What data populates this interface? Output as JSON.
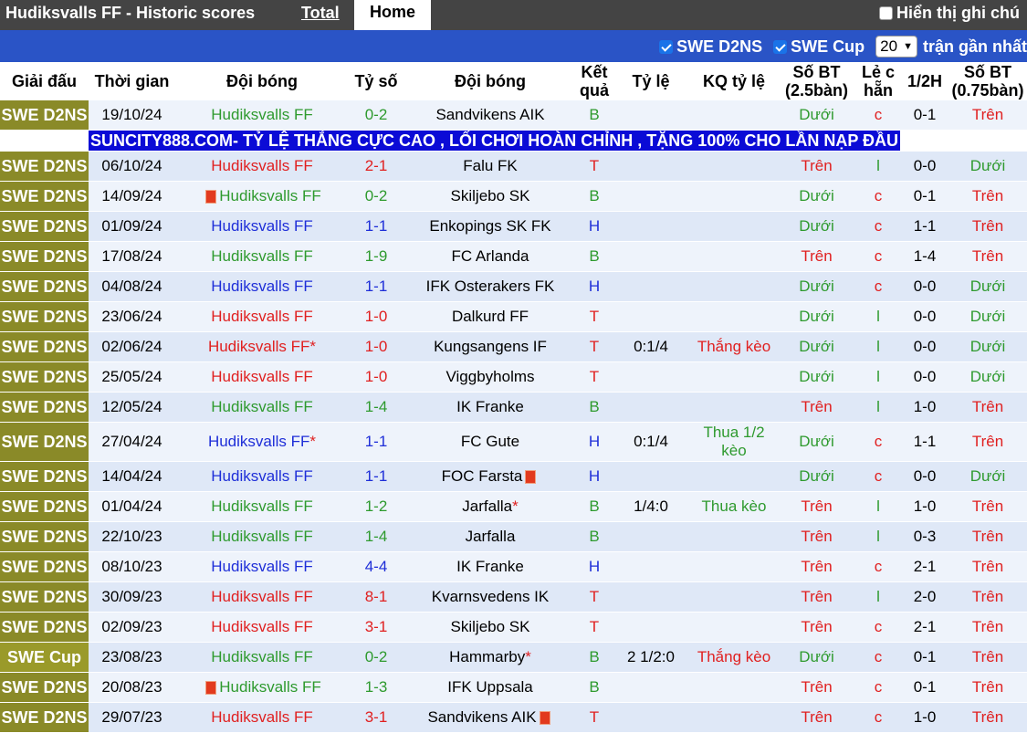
{
  "header": {
    "title": "Hudiksvalls FF - Historic scores",
    "tab_total": "Total",
    "tab_home": "Home",
    "show_notes": "Hiển thị ghi chú"
  },
  "filters": {
    "league1": "SWE D2NS",
    "league2": "SWE Cup",
    "count": "20",
    "recent_label": "trận gần nhất"
  },
  "columns": [
    "Giải đấu",
    "Thời gian",
    "Đội bóng",
    "Tỷ số",
    "Đội bóng",
    "Kết quả",
    "Tỷ lệ",
    "KQ tỷ lệ",
    "Số BT (2.5bàn)",
    "Lẻ c hẵn",
    "1/2H",
    "Số BT (0.75bàn)"
  ],
  "ad_text": "SUNCITY888.COM- TỶ LỆ THẮNG CỰC CAO , LỐI CHƠI HOÀN CHỈNH , TẶNG 100% CHO LẦN NẠP ĐẦU",
  "rows": [
    {
      "league": "SWE D2NS",
      "date": "19/10/24",
      "home": "Hudiksvalls FF",
      "hc": "g",
      "score": "0-2",
      "away": "Sandvikens AIK",
      "res": "B",
      "rc": "g",
      "odds": "",
      "oddsres": "",
      "orc": "",
      "bt": "Dưới",
      "btc": "g",
      "oe": "c",
      "oec": "r",
      "half": "0-1",
      "bt2": "Trên",
      "bt2c": "r"
    },
    {
      "league": "SWE D2NS",
      "date": "06/10/24",
      "home": "Hudiksvalls FF",
      "hc": "r",
      "score": "2-1",
      "away": "Falu FK",
      "res": "T",
      "rc": "r",
      "odds": "",
      "oddsres": "",
      "orc": "",
      "bt": "Trên",
      "btc": "r",
      "oe": "l",
      "oec": "g",
      "half": "0-0",
      "bt2": "Dưới",
      "bt2c": "g"
    },
    {
      "league": "SWE D2NS",
      "date": "14/09/24",
      "home": "Hudiksvalls FF",
      "hc": "g",
      "homecard": true,
      "score": "0-2",
      "away": "Skiljebo SK",
      "res": "B",
      "rc": "g",
      "odds": "",
      "oddsres": "",
      "orc": "",
      "bt": "Dưới",
      "btc": "g",
      "oe": "c",
      "oec": "r",
      "half": "0-1",
      "bt2": "Trên",
      "bt2c": "r"
    },
    {
      "league": "SWE D2NS",
      "date": "01/09/24",
      "home": "Hudiksvalls FF",
      "hc": "b",
      "score": "1-1",
      "away": "Enkopings SK FK",
      "res": "H",
      "rc": "b",
      "odds": "",
      "oddsres": "",
      "orc": "",
      "bt": "Dưới",
      "btc": "g",
      "oe": "c",
      "oec": "r",
      "half": "1-1",
      "bt2": "Trên",
      "bt2c": "r"
    },
    {
      "league": "SWE D2NS",
      "date": "17/08/24",
      "home": "Hudiksvalls FF",
      "hc": "g",
      "score": "1-9",
      "away": "FC Arlanda",
      "res": "B",
      "rc": "g",
      "odds": "",
      "oddsres": "",
      "orc": "",
      "bt": "Trên",
      "btc": "r",
      "oe": "c",
      "oec": "r",
      "half": "1-4",
      "bt2": "Trên",
      "bt2c": "r"
    },
    {
      "league": "SWE D2NS",
      "date": "04/08/24",
      "home": "Hudiksvalls FF",
      "hc": "b",
      "score": "1-1",
      "away": "IFK Osterakers FK",
      "res": "H",
      "rc": "b",
      "odds": "",
      "oddsres": "",
      "orc": "",
      "bt": "Dưới",
      "btc": "g",
      "oe": "c",
      "oec": "r",
      "half": "0-0",
      "bt2": "Dưới",
      "bt2c": "g"
    },
    {
      "league": "SWE D2NS",
      "date": "23/06/24",
      "home": "Hudiksvalls FF",
      "hc": "r",
      "score": "1-0",
      "away": "Dalkurd FF",
      "res": "T",
      "rc": "r",
      "odds": "",
      "oddsres": "",
      "orc": "",
      "bt": "Dưới",
      "btc": "g",
      "oe": "l",
      "oec": "g",
      "half": "0-0",
      "bt2": "Dưới",
      "bt2c": "g"
    },
    {
      "league": "SWE D2NS",
      "date": "02/06/24",
      "home": "Hudiksvalls FF",
      "hc": "r",
      "homestar": true,
      "score": "1-0",
      "away": "Kungsangens IF",
      "res": "T",
      "rc": "r",
      "odds": "0:1/4",
      "oddsres": "Thắng kèo",
      "orc": "r",
      "bt": "Dưới",
      "btc": "g",
      "oe": "l",
      "oec": "g",
      "half": "0-0",
      "bt2": "Dưới",
      "bt2c": "g"
    },
    {
      "league": "SWE D2NS",
      "date": "25/05/24",
      "home": "Hudiksvalls FF",
      "hc": "r",
      "score": "1-0",
      "away": "Viggbyholms",
      "res": "T",
      "rc": "r",
      "odds": "",
      "oddsres": "",
      "orc": "",
      "bt": "Dưới",
      "btc": "g",
      "oe": "l",
      "oec": "g",
      "half": "0-0",
      "bt2": "Dưới",
      "bt2c": "g"
    },
    {
      "league": "SWE D2NS",
      "date": "12/05/24",
      "home": "Hudiksvalls FF",
      "hc": "g",
      "score": "1-4",
      "away": "IK Franke",
      "res": "B",
      "rc": "g",
      "odds": "",
      "oddsres": "",
      "orc": "",
      "bt": "Trên",
      "btc": "r",
      "oe": "l",
      "oec": "g",
      "half": "1-0",
      "bt2": "Trên",
      "bt2c": "r"
    },
    {
      "league": "SWE D2NS",
      "date": "27/04/24",
      "home": "Hudiksvalls FF",
      "hc": "b",
      "homestar": true,
      "score": "1-1",
      "away": "FC Gute",
      "res": "H",
      "rc": "b",
      "odds": "0:1/4",
      "oddsres": "Thua 1/2 kèo",
      "orc": "g",
      "bt": "Dưới",
      "btc": "g",
      "oe": "c",
      "oec": "r",
      "half": "1-1",
      "bt2": "Trên",
      "bt2c": "r",
      "tall": true
    },
    {
      "league": "SWE D2NS",
      "date": "14/04/24",
      "home": "Hudiksvalls FF",
      "hc": "b",
      "score": "1-1",
      "away": "FOC Farsta",
      "awaycard": true,
      "res": "H",
      "rc": "b",
      "odds": "",
      "oddsres": "",
      "orc": "",
      "bt": "Dưới",
      "btc": "g",
      "oe": "c",
      "oec": "r",
      "half": "0-0",
      "bt2": "Dưới",
      "bt2c": "g"
    },
    {
      "league": "SWE D2NS",
      "date": "01/04/24",
      "home": "Hudiksvalls FF",
      "hc": "g",
      "score": "1-2",
      "away": "Jarfalla",
      "awaystar": true,
      "res": "B",
      "rc": "g",
      "odds": "1/4:0",
      "oddsres": "Thua kèo",
      "orc": "g",
      "bt": "Trên",
      "btc": "r",
      "oe": "l",
      "oec": "g",
      "half": "1-0",
      "bt2": "Trên",
      "bt2c": "r"
    },
    {
      "league": "SWE D2NS",
      "date": "22/10/23",
      "home": "Hudiksvalls FF",
      "hc": "g",
      "score": "1-4",
      "away": "Jarfalla",
      "res": "B",
      "rc": "g",
      "odds": "",
      "oddsres": "",
      "orc": "",
      "bt": "Trên",
      "btc": "r",
      "oe": "l",
      "oec": "g",
      "half": "0-3",
      "bt2": "Trên",
      "bt2c": "r"
    },
    {
      "league": "SWE D2NS",
      "date": "08/10/23",
      "home": "Hudiksvalls FF",
      "hc": "b",
      "score": "4-4",
      "away": "IK Franke",
      "res": "H",
      "rc": "b",
      "odds": "",
      "oddsres": "",
      "orc": "",
      "bt": "Trên",
      "btc": "r",
      "oe": "c",
      "oec": "r",
      "half": "2-1",
      "bt2": "Trên",
      "bt2c": "r"
    },
    {
      "league": "SWE D2NS",
      "date": "30/09/23",
      "home": "Hudiksvalls FF",
      "hc": "r",
      "score": "8-1",
      "away": "Kvarnsvedens IK",
      "res": "T",
      "rc": "r",
      "odds": "",
      "oddsres": "",
      "orc": "",
      "bt": "Trên",
      "btc": "r",
      "oe": "l",
      "oec": "g",
      "half": "2-0",
      "bt2": "Trên",
      "bt2c": "r"
    },
    {
      "league": "SWE D2NS",
      "date": "02/09/23",
      "home": "Hudiksvalls FF",
      "hc": "r",
      "score": "3-1",
      "away": "Skiljebo SK",
      "res": "T",
      "rc": "r",
      "odds": "",
      "oddsres": "",
      "orc": "",
      "bt": "Trên",
      "btc": "r",
      "oe": "c",
      "oec": "r",
      "half": "2-1",
      "bt2": "Trên",
      "bt2c": "r"
    },
    {
      "league": "SWE Cup",
      "date": "23/08/23",
      "home": "Hudiksvalls FF",
      "hc": "g",
      "score": "0-2",
      "away": "Hammarby",
      "awaystar": true,
      "res": "B",
      "rc": "g",
      "odds": "2 1/2:0",
      "oddsres": "Thắng kèo",
      "orc": "r",
      "bt": "Dưới",
      "btc": "g",
      "oe": "c",
      "oec": "r",
      "half": "0-1",
      "bt2": "Trên",
      "bt2c": "r"
    },
    {
      "league": "SWE D2NS",
      "date": "20/08/23",
      "home": "Hudiksvalls FF",
      "hc": "g",
      "homecard": true,
      "score": "1-3",
      "away": "IFK Uppsala",
      "res": "B",
      "rc": "g",
      "odds": "",
      "oddsres": "",
      "orc": "",
      "bt": "Trên",
      "btc": "r",
      "oe": "c",
      "oec": "r",
      "half": "0-1",
      "bt2": "Trên",
      "bt2c": "r"
    },
    {
      "league": "SWE D2NS",
      "date": "29/07/23",
      "home": "Hudiksvalls FF",
      "hc": "r",
      "score": "3-1",
      "away": "Sandvikens AIK",
      "awaycard": true,
      "res": "T",
      "rc": "r",
      "odds": "",
      "oddsres": "",
      "orc": "",
      "bt": "Trên",
      "btc": "r",
      "oe": "c",
      "oec": "r",
      "half": "1-0",
      "bt2": "Trên",
      "bt2c": "r"
    }
  ]
}
